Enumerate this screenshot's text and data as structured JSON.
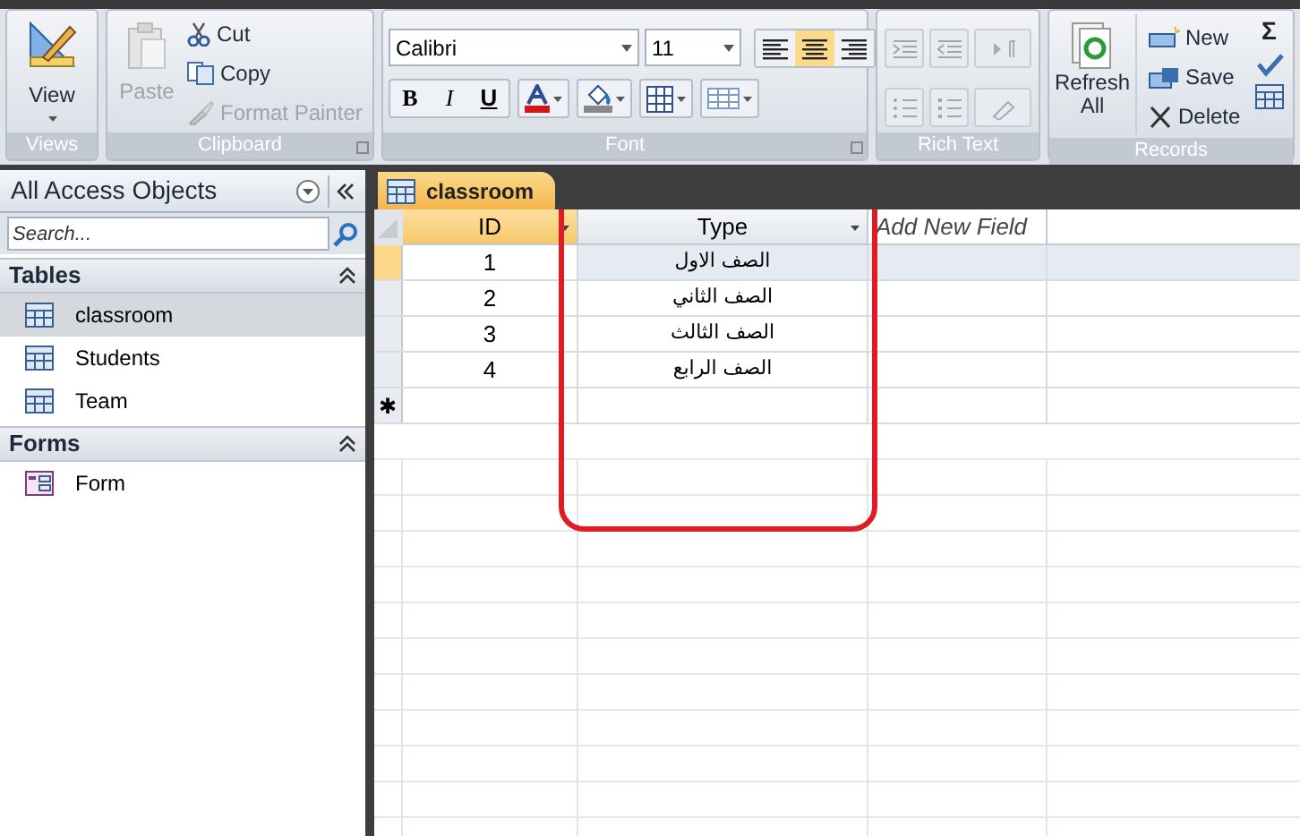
{
  "ribbon": {
    "groups": [
      {
        "label": "Views",
        "kind": "views",
        "buttons": [
          {
            "label": "View",
            "disabled": false
          }
        ]
      },
      {
        "label": "Clipboard",
        "kind": "clipboard",
        "buttons": [
          {
            "label": "Paste",
            "disabled": true
          },
          {
            "label": "Cut",
            "disabled": false
          },
          {
            "label": "Copy",
            "disabled": false
          },
          {
            "label": "Format Painter",
            "disabled": true
          }
        ]
      },
      {
        "label": "Font",
        "kind": "font",
        "font": "Calibri",
        "size": "11",
        "alignments": [
          {
            "kind": "left",
            "selected": false
          },
          {
            "kind": "center",
            "selected": true
          },
          {
            "kind": "right",
            "selected": false
          }
        ],
        "styles": [
          "B",
          "I",
          "U"
        ]
      },
      {
        "label": "Rich Text",
        "kind": "richtext"
      },
      {
        "label": "Records",
        "kind": "records",
        "buttons": [
          {
            "label": "Refresh All",
            "disabled": false
          },
          {
            "label": "New",
            "disabled": false
          },
          {
            "label": "Save",
            "disabled": false
          },
          {
            "label": "Delete",
            "disabled": false
          }
        ],
        "extra": "Σ"
      }
    ]
  },
  "navigation": {
    "title": "All Access Objects",
    "search": {
      "placeholder": "Search..."
    },
    "sections": [
      {
        "title": "Tables",
        "kind": "table",
        "items": [
          {
            "label": "classroom",
            "selected": true
          },
          {
            "label": "Students",
            "selected": false
          },
          {
            "label": "Team",
            "selected": false
          }
        ]
      },
      {
        "title": "Forms",
        "kind": "form",
        "items": [
          {
            "label": "Form",
            "selected": false
          }
        ]
      }
    ]
  },
  "document_tab": {
    "label": "classroom"
  },
  "table": {
    "columns": [
      "ID",
      "Type",
      "Add New Field"
    ],
    "rows": [
      {
        "cells": [
          "1",
          "الصف الاول"
        ],
        "selected": true
      },
      {
        "cells": [
          "2",
          "الصف الثاني"
        ],
        "selected": false
      },
      {
        "cells": [
          "3",
          "الصف الثالث"
        ],
        "selected": false
      },
      {
        "cells": [
          "4",
          "الصف الرابع"
        ],
        "selected": false
      }
    ],
    "new_row_marker": "✱"
  }
}
